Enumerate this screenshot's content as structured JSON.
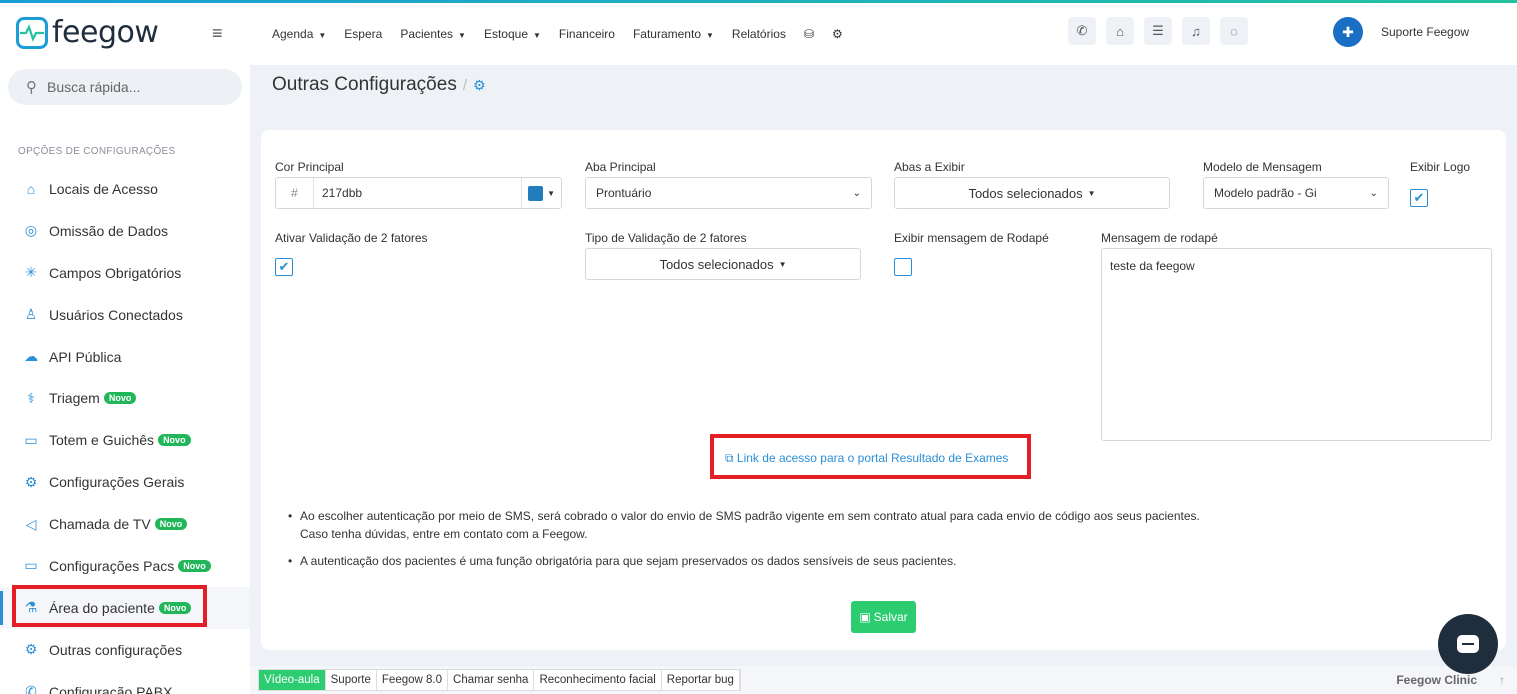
{
  "brand": {
    "logo_text": "feegow"
  },
  "search": {
    "placeholder": "Busca rápida..."
  },
  "sidebar": {
    "heading": "OPÇÕES DE CONFIGURAÇÕES",
    "items": [
      {
        "label": "Locais de Acesso",
        "icon": "building-icon",
        "glyph": "⌂",
        "badge": ""
      },
      {
        "label": "Omissão de Dados",
        "icon": "eye-slash-icon",
        "glyph": "◎",
        "badge": ""
      },
      {
        "label": "Campos Obrigatórios",
        "icon": "asterisk-icon",
        "glyph": "✳",
        "badge": ""
      },
      {
        "label": "Usuários Conectados",
        "icon": "user-icon",
        "glyph": "♙",
        "badge": ""
      },
      {
        "label": "API Pública",
        "icon": "cloud-upload-icon",
        "glyph": "☁",
        "badge": ""
      },
      {
        "label": "Triagem",
        "icon": "stethoscope-icon",
        "glyph": "⚕",
        "badge": "Novo"
      },
      {
        "label": "Totem e Guichês",
        "icon": "laptop-icon",
        "glyph": "▭",
        "badge": "Novo"
      },
      {
        "label": "Configurações Gerais",
        "icon": "cogs-icon",
        "glyph": "⚙",
        "badge": ""
      },
      {
        "label": "Chamada de TV",
        "icon": "megaphone-icon",
        "glyph": "◁",
        "badge": "Novo"
      },
      {
        "label": "Configurações Pacs",
        "icon": "laptop-icon",
        "glyph": "▭",
        "badge": "Novo"
      },
      {
        "label": "Área do paciente",
        "icon": "flask-icon",
        "glyph": "⚗",
        "badge": "Novo"
      },
      {
        "label": "Outras configurações",
        "icon": "cogs-icon",
        "glyph": "⚙",
        "badge": ""
      },
      {
        "label": "Configuração PABX",
        "icon": "phone-icon",
        "glyph": "✆",
        "badge": ""
      }
    ],
    "active_index": 10
  },
  "topnav": {
    "menu": [
      {
        "label": "Agenda",
        "dropdown": true
      },
      {
        "label": "Espera",
        "dropdown": false
      },
      {
        "label": "Pacientes",
        "dropdown": true
      },
      {
        "label": "Estoque",
        "dropdown": true
      },
      {
        "label": "Financeiro",
        "dropdown": false
      },
      {
        "label": "Faturamento",
        "dropdown": true
      },
      {
        "label": "Relatórios",
        "dropdown": false
      }
    ],
    "extra_icons": [
      "database-icon",
      "gear-icon"
    ],
    "action_icons": [
      "phone-icon",
      "inbox-icon",
      "tasks-icon",
      "bell-icon",
      "chat-icon"
    ],
    "user_name": "Suporte Feegow"
  },
  "page": {
    "title": "Outras Configurações",
    "separator": "/"
  },
  "form": {
    "cor_principal": {
      "label": "Cor Principal",
      "prefix": "#",
      "value": "217dbb",
      "swatch": "#217dbb"
    },
    "aba_principal": {
      "label": "Aba Principal",
      "value": "Prontuário"
    },
    "abas_exibir": {
      "label": "Abas a Exibir",
      "value": "Todos selecionados"
    },
    "modelo_mensagem": {
      "label": "Modelo de Mensagem",
      "value": "Modelo padrão - Gi"
    },
    "exibir_logo": {
      "label": "Exibir Logo",
      "checked": true
    },
    "validacao_2f": {
      "label": "Ativar Validação de 2 fatores",
      "checked": true
    },
    "tipo_validacao": {
      "label": "Tipo de Validação de 2 fatores",
      "value": "Todos selecionados"
    },
    "exibir_rodape": {
      "label": "Exibir mensagem de Rodapé",
      "checked": false
    },
    "mensagem_rodape": {
      "label": "Mensagem de rodapé",
      "value": "teste da feegow"
    },
    "portal_link": "Link de acesso para o portal Resultado de Exames",
    "notes": [
      "Ao escolher autenticação por meio de SMS, será cobrado o valor do envio de SMS padrão vigente em sem contrato atual para cada envio de código aos seus pacientes.",
      "Caso tenha dúvidas, entre em contato com a Feegow.",
      "A autenticação dos pacientes é uma função obrigatória para que sejam preservados os dados sensíveis de seus pacientes."
    ],
    "save_label": "Salvar"
  },
  "footer": {
    "items": [
      "Vídeo-aula",
      "Suporte",
      "Feegow 8.0",
      "Chamar senha",
      "Reconhecimento facial",
      "Reportar bug"
    ],
    "brand": "Feegow Clinic"
  },
  "colors": {
    "accent": "#2a8fd6",
    "highlight": "#e41e25",
    "success": "#2ecc71"
  }
}
